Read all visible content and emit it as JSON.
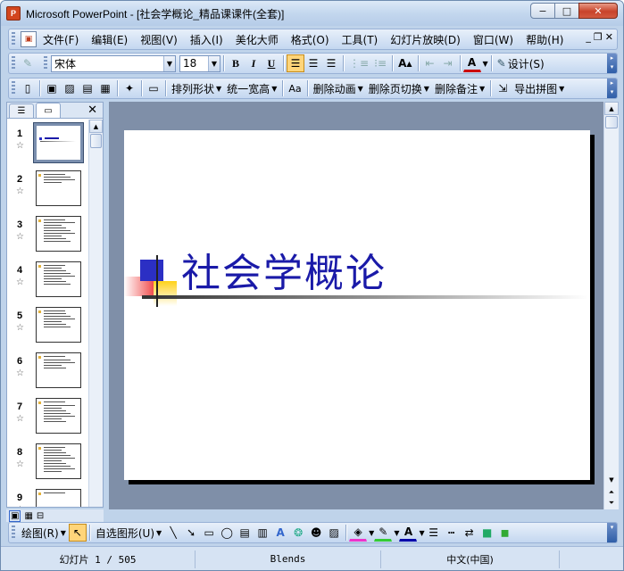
{
  "window": {
    "title": "Microsoft PowerPoint - [社会学概论_精品课课件(全套)]",
    "buttons": {
      "minimize": "−",
      "maximize": "□",
      "close": "✕"
    }
  },
  "menubar": {
    "items": [
      {
        "label": "文件(F)"
      },
      {
        "label": "编辑(E)"
      },
      {
        "label": "视图(V)"
      },
      {
        "label": "插入(I)"
      },
      {
        "label": "美化大师"
      },
      {
        "label": "格式(O)"
      },
      {
        "label": "工具(T)"
      },
      {
        "label": "幻灯片放映(D)"
      },
      {
        "label": "窗口(W)"
      },
      {
        "label": "帮助(H)"
      }
    ],
    "doc_controls": {
      "minimize": "_",
      "restore": "❐",
      "close": "✕"
    }
  },
  "format_toolbar": {
    "font_name": "宋体",
    "font_size": "18",
    "bold": "B",
    "italic": "I",
    "underline": "U",
    "design_label": "设计(S)"
  },
  "tools_toolbar": {
    "arrange_shapes": "排列形状",
    "uniform_width": "统一宽高",
    "delete_animation": "删除动画",
    "delete_transition": "删除页切换",
    "delete_notes": "删除备注",
    "export_image": "导出拼图"
  },
  "slide_panel": {
    "thumbnails": [
      {
        "number": "1",
        "selected": true
      },
      {
        "number": "2",
        "selected": false
      },
      {
        "number": "3",
        "selected": false
      },
      {
        "number": "4",
        "selected": false
      },
      {
        "number": "5",
        "selected": false
      },
      {
        "number": "6",
        "selected": false
      },
      {
        "number": "7",
        "selected": false
      },
      {
        "number": "8",
        "selected": false
      },
      {
        "number": "9",
        "selected": false
      }
    ],
    "star": "☆"
  },
  "slide": {
    "title": "社会学概论",
    "colors": {
      "title": "#1a1aa8",
      "square_blue": "#2b2fc4",
      "square_red": "#f04a4a",
      "square_yellow": "#ffd21a"
    }
  },
  "drawing_toolbar": {
    "draw_label": "绘图(R)",
    "autoshapes_label": "自选图形(U)"
  },
  "statusbar": {
    "slide_position": "幻灯片 1 / 505",
    "design_template": "Blends",
    "language": "中文(中国)"
  }
}
